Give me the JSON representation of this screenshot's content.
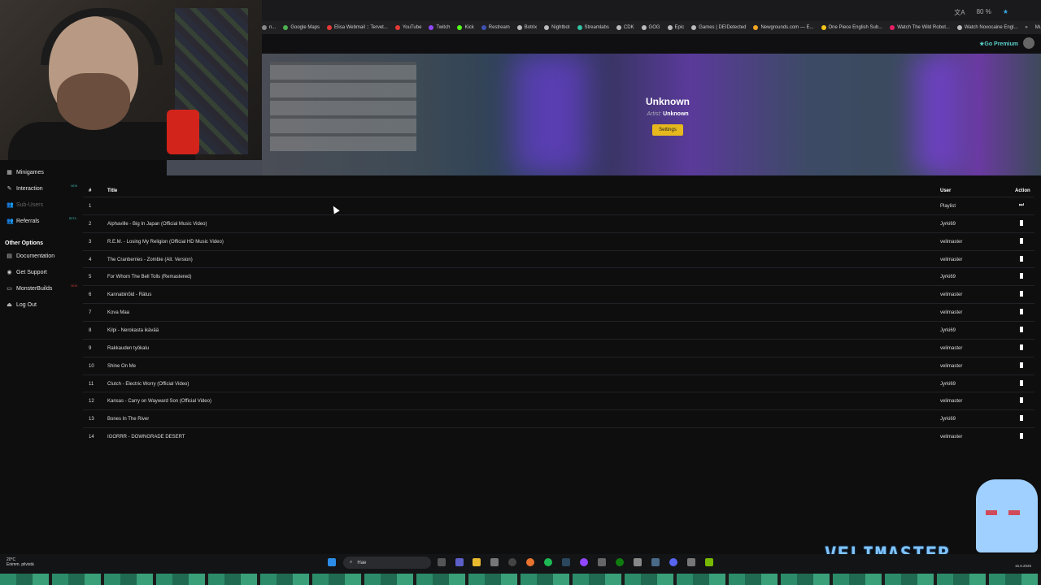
{
  "browser": {
    "bookmarks": [
      {
        "label": "n...",
        "color": "#888888"
      },
      {
        "label": "Google Maps",
        "color": "#4caf50"
      },
      {
        "label": "Elisa Webmail :: Tervet...",
        "color": "#e53935"
      },
      {
        "label": "YouTube",
        "color": "#e53935"
      },
      {
        "label": "Twitch",
        "color": "#9146ff"
      },
      {
        "label": "Kick",
        "color": "#53fc18"
      },
      {
        "label": "Restream",
        "color": "#3f51b5"
      },
      {
        "label": "Botrix",
        "color": "#bbbbbb"
      },
      {
        "label": "Nightbot",
        "color": "#bbbbbb"
      },
      {
        "label": "Streamlabs",
        "color": "#31c3a2"
      },
      {
        "label": "CDK",
        "color": "#bbbbbb"
      },
      {
        "label": "GOG",
        "color": "#bbbbbb"
      },
      {
        "label": "Epic",
        "color": "#bbbbbb"
      },
      {
        "label": "Games | DEIDetected",
        "color": "#bbbbbb"
      },
      {
        "label": "Newgrounds.com — E...",
        "color": "#f5a623"
      },
      {
        "label": "One Piece English Sub...",
        "color": "#f5c518"
      },
      {
        "label": "Watch The Wild Robot...",
        "color": "#e91e63"
      },
      {
        "label": "Watch Novocaine Engl...",
        "color": "#bbbbbb"
      }
    ],
    "bookmarks_more": "»",
    "other_bookmarks": "Muut kirjanmerkit",
    "zoom": "80 %"
  },
  "app": {
    "premium": "Go Premium"
  },
  "now_playing": {
    "title": "Unknown",
    "artist_label": "Artist:",
    "artist_value": "Unknown",
    "settings": "Settings"
  },
  "sidebar": {
    "items": [
      {
        "label": "Minigames",
        "icon": "grid-icon"
      },
      {
        "label": "Interaction",
        "icon": "pen-icon",
        "badge": "NEW"
      },
      {
        "label": "Sub-Users",
        "icon": "users-icon"
      },
      {
        "label": "Referrals",
        "icon": "users-icon",
        "badge": "BETA"
      }
    ],
    "other_header": "Other Options",
    "other_items": [
      {
        "label": "Documentation",
        "icon": "book-icon"
      },
      {
        "label": "Get Support",
        "icon": "support-icon"
      },
      {
        "label": "MonsterBuilds",
        "icon": "monitor-icon",
        "badge": "NEW"
      },
      {
        "label": "Log Out",
        "icon": "logout-icon"
      }
    ]
  },
  "queue": {
    "headers": {
      "num": "#",
      "title": "Title",
      "user": "User",
      "action": "Action"
    },
    "rows": [
      {
        "num": "1",
        "title": "",
        "user": "Playlist",
        "action": "play"
      },
      {
        "num": "2",
        "title": "Alphaville - Big In Japan (Official Music Video)",
        "user": "Jyrki69",
        "action": "delete"
      },
      {
        "num": "3",
        "title": "R.E.M. - Losing My Religion (Official HD Music Video)",
        "user": "velimaster",
        "action": "delete"
      },
      {
        "num": "4",
        "title": "The Cranberries - Zombie (Alt. Version)",
        "user": "velimaster",
        "action": "delete"
      },
      {
        "num": "5",
        "title": "For Whom The Bell Tolls (Remastered)",
        "user": "Jyrki69",
        "action": "delete"
      },
      {
        "num": "6",
        "title": "Kannabinõid - Rätus",
        "user": "velimaster",
        "action": "delete"
      },
      {
        "num": "7",
        "title": "Kova Maa",
        "user": "velimaster",
        "action": "delete"
      },
      {
        "num": "8",
        "title": "Kilpi - Nerokasta ikävää",
        "user": "Jyrki69",
        "action": "delete"
      },
      {
        "num": "9",
        "title": "Rakkauden työkalu",
        "user": "velimaster",
        "action": "delete"
      },
      {
        "num": "10",
        "title": "Shine On Me",
        "user": "velimaster",
        "action": "delete"
      },
      {
        "num": "11",
        "title": "Clutch - Electric Worry (Official Video)",
        "user": "Jyrki69",
        "action": "delete"
      },
      {
        "num": "12",
        "title": "Kansas - Carry on Wayward Son (Official Video)",
        "user": "velimaster",
        "action": "delete"
      },
      {
        "num": "13",
        "title": "Bones In The River",
        "user": "Jyrki69",
        "action": "delete"
      },
      {
        "num": "14",
        "title": "IGORRR - DOWNGRADE DESERT",
        "user": "velimaster",
        "action": "delete"
      }
    ]
  },
  "taskbar": {
    "weather_temp": "20°C",
    "weather_desc": "Enimm. pilvistä",
    "search_placeholder": "Hae",
    "date": "15.8.2025"
  },
  "overlay": {
    "brand": "VELIMASTER"
  }
}
